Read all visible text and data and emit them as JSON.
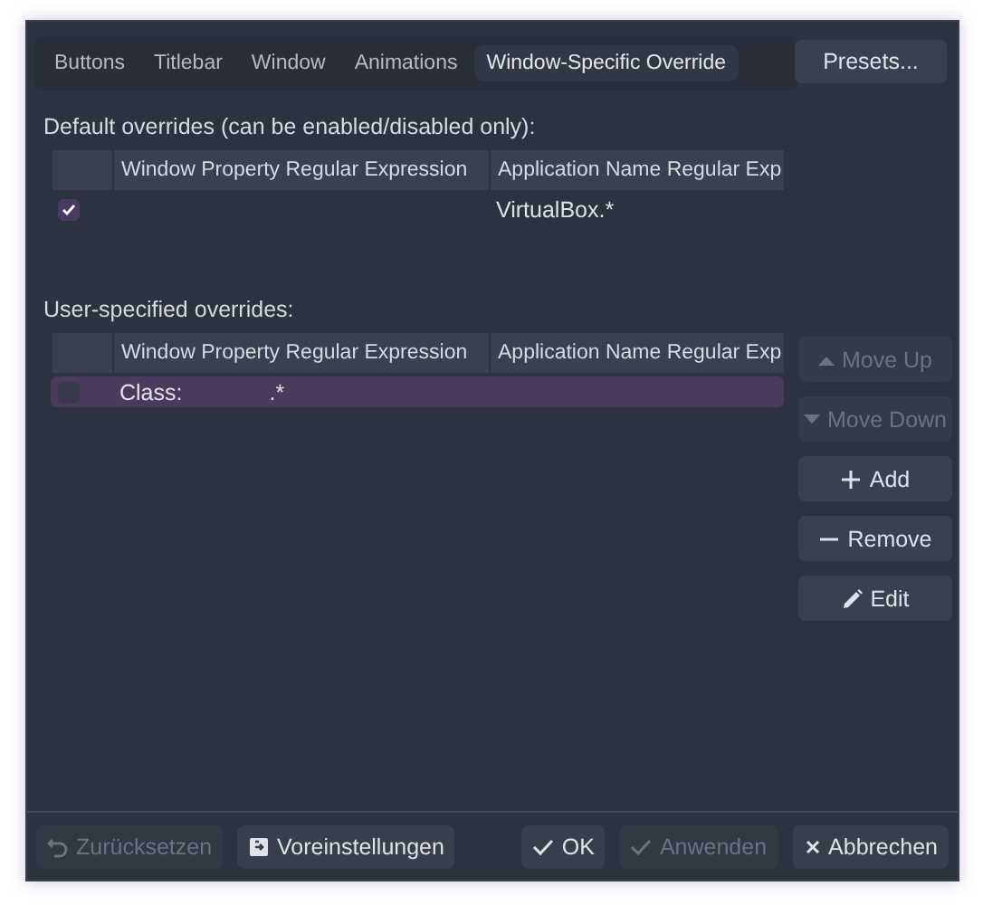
{
  "tabs": [
    {
      "label": "Buttons",
      "selected": false
    },
    {
      "label": "Titlebar",
      "selected": false
    },
    {
      "label": "Window",
      "selected": false
    },
    {
      "label": "Animations",
      "selected": false
    },
    {
      "label": "Window-Specific Override",
      "selected": true
    }
  ],
  "presets_button": "Presets...",
  "default_overrides": {
    "label": "Default overrides (can be enabled/disabled only):",
    "columns": [
      "Window Property Regular Expression",
      "Application Name Regular Exp"
    ],
    "rows": [
      {
        "checked": true,
        "selected": false,
        "application_name": "VirtualBox.*"
      }
    ]
  },
  "user_overrides": {
    "label": "User-specified overrides:",
    "columns": [
      "Window Property Regular Expression",
      "Application Name Regular Exp"
    ],
    "rows": [
      {
        "checked": false,
        "selected": true,
        "window_property": {
          "label": "Class:",
          "value": ".*"
        }
      }
    ]
  },
  "side_buttons": [
    {
      "label": "Move Up",
      "kind": "up",
      "disabled": true
    },
    {
      "label": "Move Down",
      "kind": "down",
      "disabled": true
    },
    {
      "label": "Add",
      "kind": "plus",
      "disabled": false
    },
    {
      "label": "Remove",
      "kind": "minus",
      "disabled": false
    },
    {
      "label": "Edit",
      "kind": "pencil",
      "disabled": false
    }
  ],
  "footer_left": [
    {
      "label": "Zurücksetzen",
      "kind": "undo",
      "disabled": true
    },
    {
      "label": "Voreinstellungen",
      "kind": "defaults",
      "disabled": false
    }
  ],
  "footer_right": [
    {
      "label": "OK",
      "kind": "check",
      "disabled": false
    },
    {
      "label": "Anwenden",
      "kind": "check",
      "disabled": true
    },
    {
      "label": "Abbrechen",
      "kind": "close",
      "disabled": false
    }
  ]
}
